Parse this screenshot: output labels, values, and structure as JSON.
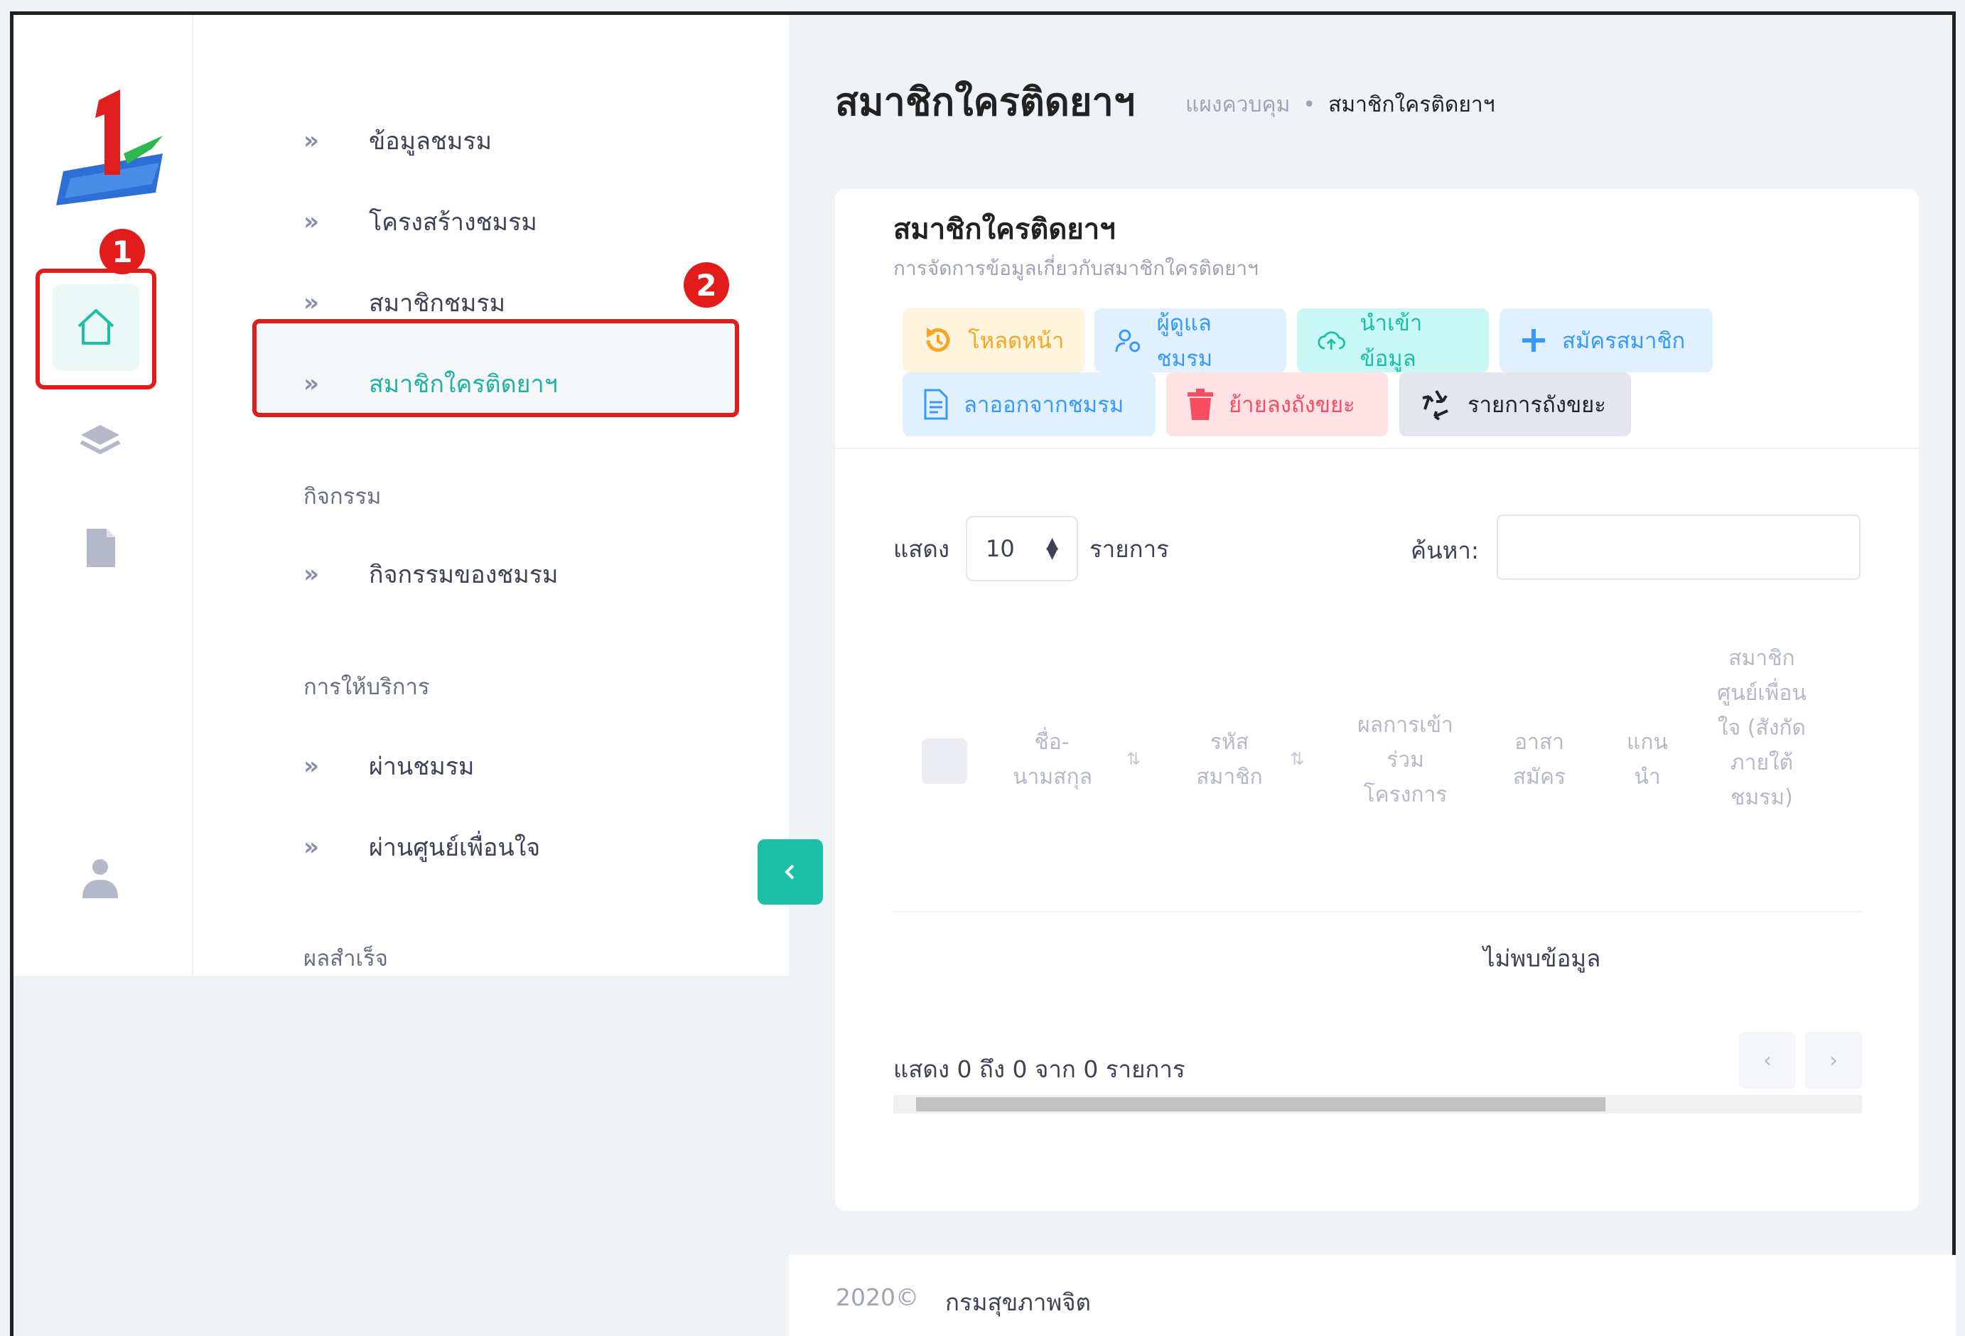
{
  "page": {
    "title": "สมาชิกใครติดยาฯ",
    "breadcrumb": [
      "แผงควบคุม",
      "สมาชิกใครติดยาฯ"
    ]
  },
  "annotations": [
    "1",
    "2"
  ],
  "menu": {
    "items_top": [
      {
        "label": "ข้อมูลชมรม"
      },
      {
        "label": "โครงสร้างชมรม"
      },
      {
        "label": "สมาชิกชมรม"
      },
      {
        "label": "สมาชิกใครติดยาฯ",
        "active": true
      }
    ],
    "section_activity": "กิจกรรม",
    "items_activity": [
      {
        "label": "กิจกรรมของชมรม"
      }
    ],
    "section_service": "การให้บริการ",
    "items_service": [
      {
        "label": "ผ่านชมรม"
      },
      {
        "label": "ผ่านศูนย์เพื่อนใจ"
      }
    ],
    "section_result": "ผลสำเร็จ"
  },
  "card": {
    "title": "สมาชิกใครติดยาฯ",
    "subtitle": "การจัดการข้อมูลเกี่ยวกับสมาชิกใครติดยาฯ",
    "buttons": {
      "reload": "โหลดหน้า",
      "club_admin": "ผู้ดูแลชมรม",
      "import": "นำเข้าข้อมูล",
      "register": "สมัครสมาชิก",
      "leave": "ลาออกจากชมรม",
      "to_trash": "ย้ายลงถังขยะ",
      "trash_list": "รายการถังขยะ"
    },
    "colors": {
      "reload": "#fff4de",
      "club_admin": "#e1f0ff",
      "import": "#c9f7f5",
      "register": "#e1f0ff",
      "leave": "#e1f0ff",
      "to_trash": "#ffe2e5",
      "trash_list": "#e4e6ef"
    },
    "length": {
      "show": "แสดง",
      "value": "10",
      "entries": "รายการ"
    },
    "search_label": "ค้นหา:",
    "search_value": "",
    "columns": [
      "ชื่อ-นามสกุล",
      "รหัสสมาชิก",
      "ผลการเข้าร่วมโครงการ",
      "อาสาสมัคร",
      "แกนนำ",
      "สมาชิกศูนย์เพื่อนใจ (สังกัดภายใต้ชมรม)"
    ],
    "empty": "ไม่พบข้อมูล",
    "info": "แสดง 0 ถึง 0 จาก 0 รายการ",
    "pager": {
      "prev": "‹",
      "next": "›"
    }
  },
  "footer": {
    "year": "2020©",
    "org": "กรมสุขภาพจิต"
  },
  "theme": {
    "accent": "#1bbfa8",
    "annotation_red": "#e21b1b"
  }
}
